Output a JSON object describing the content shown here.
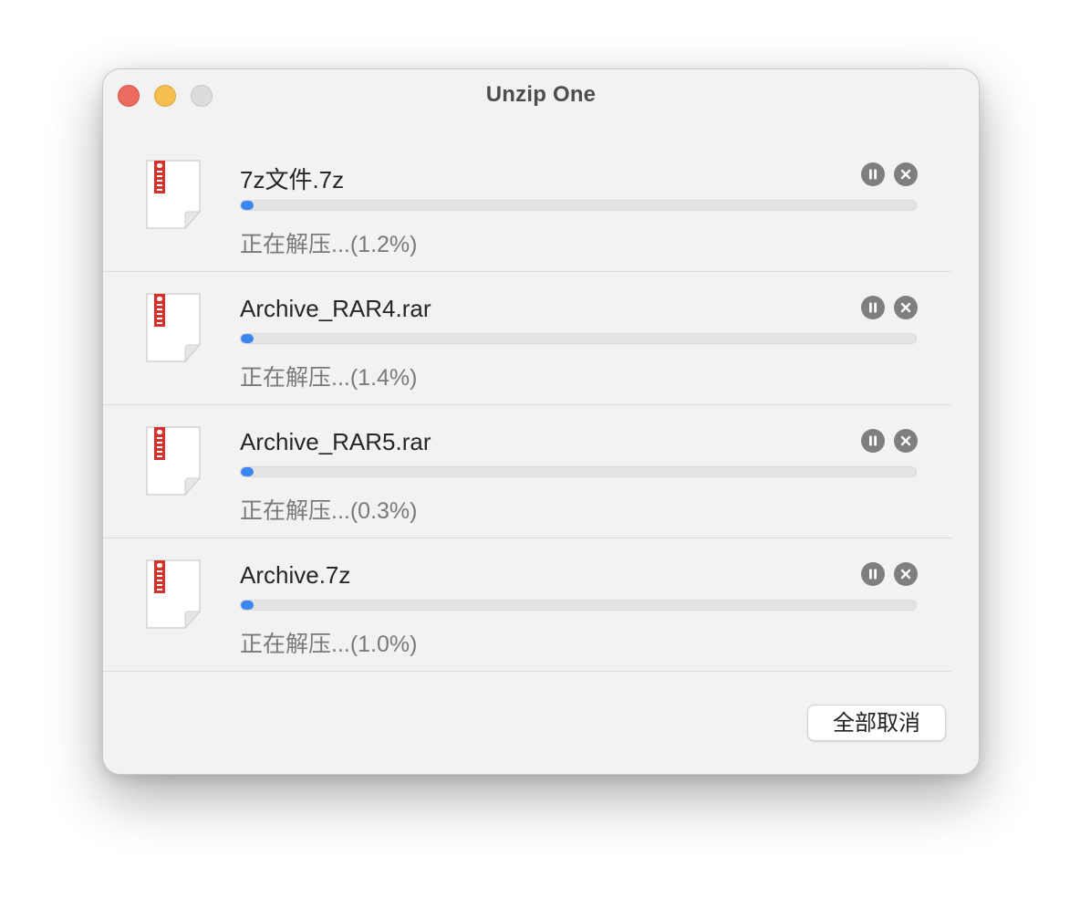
{
  "window": {
    "title": "Unzip One"
  },
  "colors": {
    "progress_fill": "#3b86f0",
    "zip_icon_accent": "#d6322c",
    "close_light": "#ed6a5e",
    "minimize_light": "#f5bf4f",
    "zoom_light": "#dcdcdc"
  },
  "tasks": [
    {
      "file_name": "7z文件.7z",
      "status": "正在解压...(1.2%)",
      "progress_percent": 1.2,
      "icon": "zip-archive-icon"
    },
    {
      "file_name": "Archive_RAR4.rar",
      "status": "正在解压...(1.4%)",
      "progress_percent": 1.4,
      "icon": "zip-archive-icon"
    },
    {
      "file_name": "Archive_RAR5.rar",
      "status": "正在解压...(0.3%)",
      "progress_percent": 0.3,
      "icon": "zip-archive-icon"
    },
    {
      "file_name": "Archive.7z",
      "status": "正在解压...(1.0%)",
      "progress_percent": 1.0,
      "icon": "zip-archive-icon"
    }
  ],
  "row_action_icons": [
    "pause-icon",
    "close-icon"
  ],
  "footer": {
    "cancel_all_label": "全部取消"
  }
}
